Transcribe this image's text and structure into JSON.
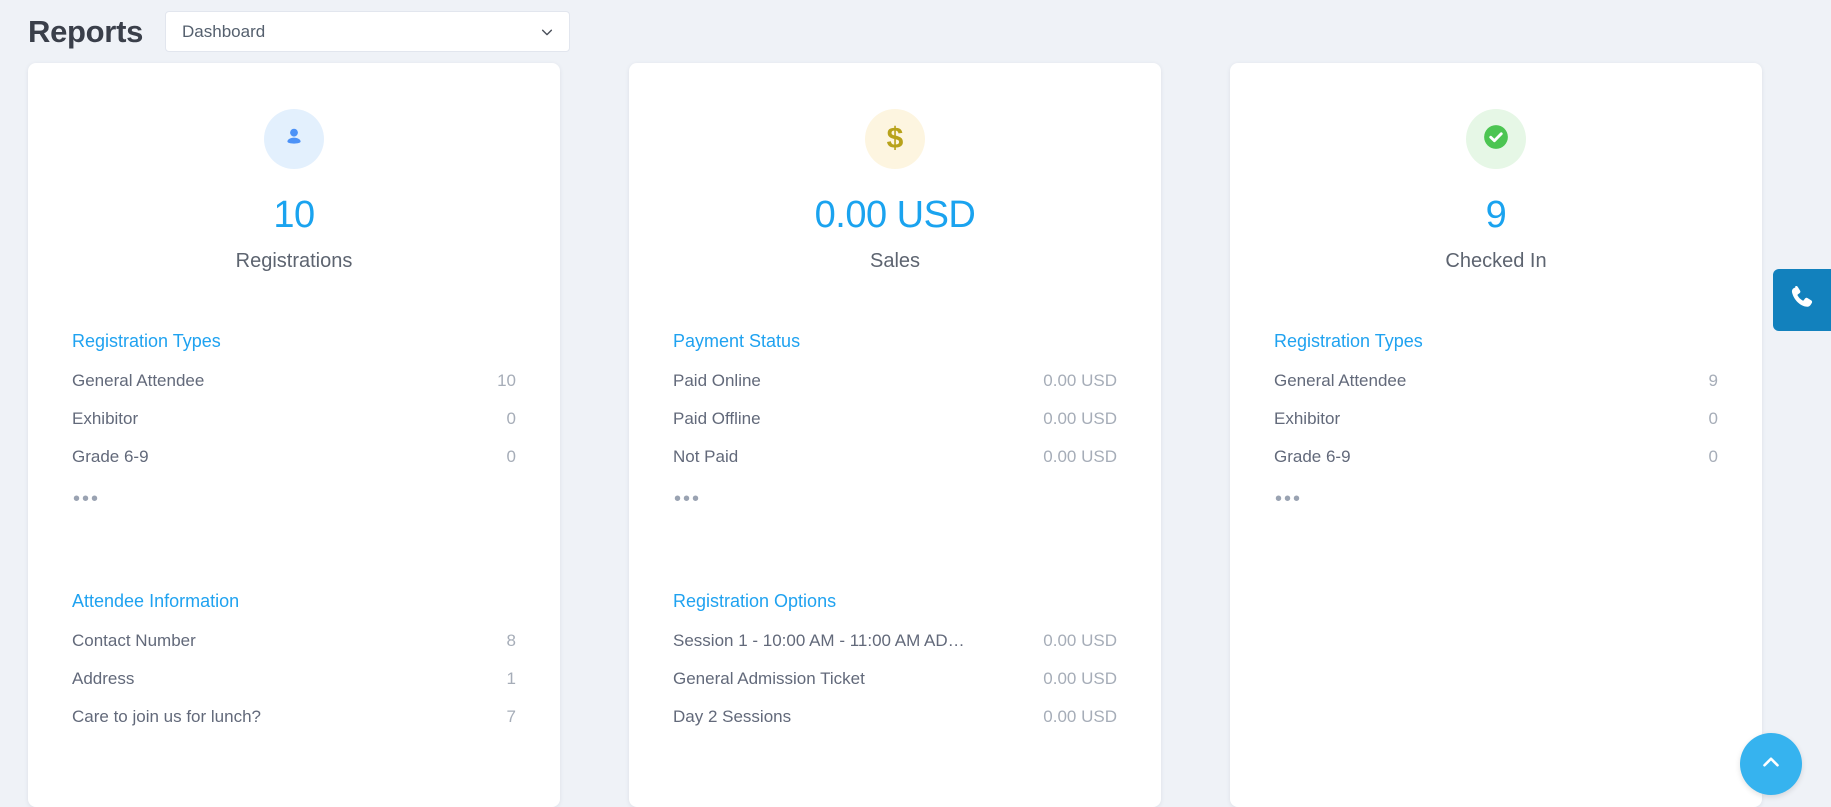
{
  "header": {
    "title": "Reports",
    "report_select": {
      "value": "Dashboard",
      "icon": "chevron-down-icon"
    }
  },
  "colors": {
    "accent_blue": "#1aa3ef",
    "section_title_blue": "#1fa2f0",
    "icon_blue": "#4c92f7",
    "icon_blue_bg": "#e3f0fd",
    "icon_yellow": "#b8a21a",
    "icon_yellow_bg": "#fdf5e0",
    "icon_green": "#4cc552",
    "icon_green_bg": "#e6f7e6",
    "page_bg": "#eff2f7",
    "card_bg": "#ffffff",
    "label_text": "#62697a",
    "value_text": "#a6adb8",
    "phone_tab_blue": "#1281bd",
    "scroll_top_blue": "#36b3ef"
  },
  "cards": [
    {
      "id": "registrations",
      "icon": "person-icon",
      "icon_style": "blue",
      "value": "10",
      "label": "Registrations",
      "sections": [
        {
          "title": "Registration Types",
          "rows": [
            {
              "label": "General Attendee",
              "value": "10"
            },
            {
              "label": "Exhibitor",
              "value": "0"
            },
            {
              "label": "Grade 6-9",
              "value": "0"
            }
          ],
          "more": "•••"
        },
        {
          "title": "Attendee Information",
          "rows": [
            {
              "label": "Contact Number",
              "value": "8"
            },
            {
              "label": "Address",
              "value": "1"
            },
            {
              "label": "Care to join us for lunch?",
              "value": "7"
            }
          ],
          "more": ""
        }
      ]
    },
    {
      "id": "sales",
      "icon": "dollar-icon",
      "icon_style": "yellow",
      "value": "0.00 USD",
      "label": "Sales",
      "sections": [
        {
          "title": "Payment Status",
          "rows": [
            {
              "label": "Paid Online",
              "value": "0.00 USD"
            },
            {
              "label": "Paid Offline",
              "value": "0.00 USD"
            },
            {
              "label": "Not Paid",
              "value": "0.00 USD"
            }
          ],
          "more": "•••"
        },
        {
          "title": "Registration Options",
          "rows": [
            {
              "label": "Session 1 - 10:00 AM - 11:00 AM AD…",
              "value": "0.00 USD"
            },
            {
              "label": "General Admission Ticket",
              "value": "0.00 USD"
            },
            {
              "label": "Day 2 Sessions",
              "value": "0.00 USD"
            }
          ],
          "more": ""
        }
      ]
    },
    {
      "id": "checked-in",
      "icon": "check-circle-icon",
      "icon_style": "green",
      "value": "9",
      "label": "Checked In",
      "sections": [
        {
          "title": "Registration Types",
          "rows": [
            {
              "label": "General Attendee",
              "value": "9"
            },
            {
              "label": "Exhibitor",
              "value": "0"
            },
            {
              "label": "Grade 6-9",
              "value": "0"
            }
          ],
          "more": "•••"
        }
      ]
    }
  ],
  "widgets": {
    "phone_tab": {
      "icon": "phone-icon"
    },
    "scroll_top": {
      "icon": "chevron-up-icon"
    }
  }
}
